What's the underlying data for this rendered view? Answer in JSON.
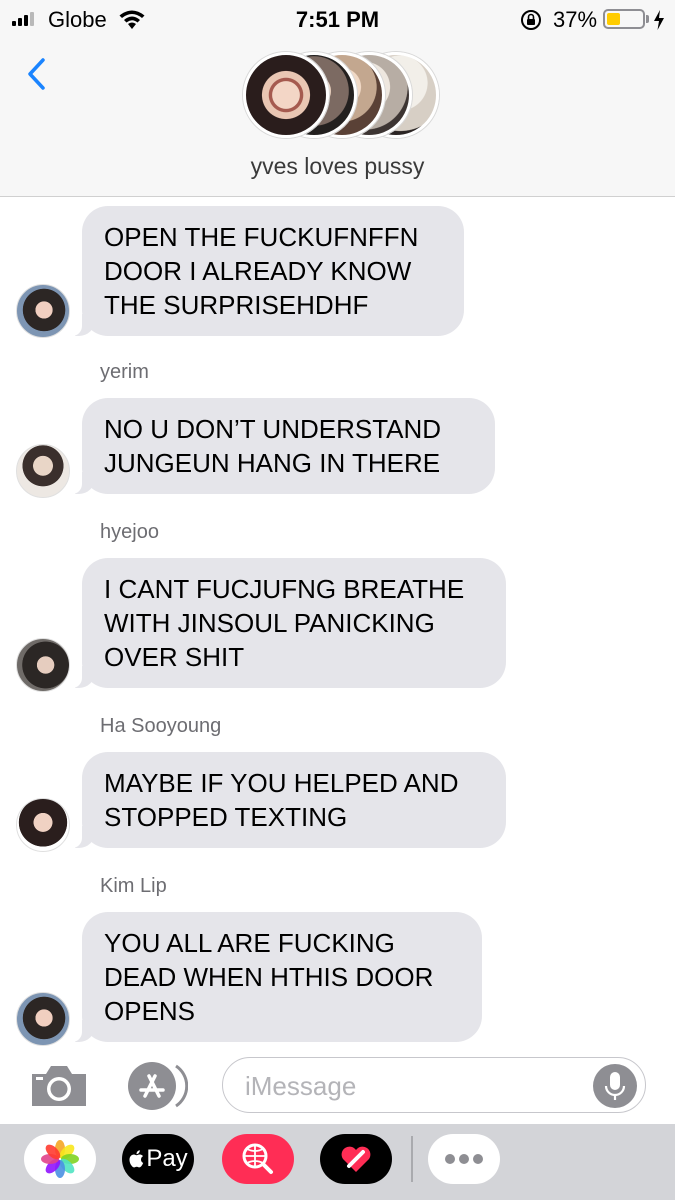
{
  "status_bar": {
    "carrier": "Globe",
    "time": "7:51 PM",
    "battery_percent": "37%",
    "battery_level": 0.37,
    "signal_bars": 3,
    "icons": [
      "signal-icon",
      "wifi-icon",
      "orientation-lock-icon",
      "battery-icon",
      "charging-bolt-icon"
    ]
  },
  "header": {
    "back_icon": "chevron-left-icon",
    "group_name": "yves loves pussy",
    "avatar_count": 5
  },
  "messages": [
    {
      "sender": "",
      "text": "OPEN THE FUCKUFNFFN\nDOOR I ALREADY KNOW\nTHE SURPRISEHDHF"
    },
    {
      "sender": "yerim",
      "text": "NO U DON’T UNDERSTAND\nJUNGEUN HANG IN THERE"
    },
    {
      "sender": "hyejoo",
      "text": "I CANT FUCJUFNG BREATHE\nWITH JINSOUL PANICKING\nOVER SHIT"
    },
    {
      "sender": "Ha Sooyoung",
      "text": "MAYBE IF YOU HELPED AND\nSTOPPED TEXTING"
    },
    {
      "sender": "Kim Lip",
      "text": "YOU ALL ARE FUCKING\nDEAD WHEN HTHIS DOOR\nOPENS"
    }
  ],
  "input_bar": {
    "placeholder": "iMessage",
    "value": "",
    "icons": [
      "camera-icon",
      "app-store-icon",
      "microphone-icon"
    ]
  },
  "app_drawer": {
    "apps": [
      "photos-app-icon",
      "apple-pay-icon",
      "web-image-search-icon",
      "digital-touch-icon",
      "more-apps-icon"
    ],
    "pay_label": "Pay"
  },
  "colors": {
    "bubble_gray": "#e5e5ea",
    "ios_blue": "#1a84ff",
    "battery_yellow": "#ffcc00",
    "bar_bg": "#f7f7f7",
    "drawer_bg": "#d3d4d8"
  }
}
